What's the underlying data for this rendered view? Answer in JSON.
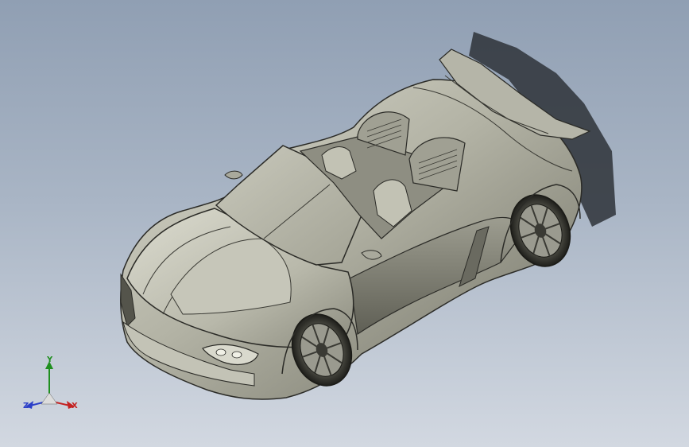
{
  "viewport": {
    "background_top": "#909fb3",
    "background_bottom": "#d2d8e1",
    "model": "sports-car-roadster",
    "model_color": "#b9b9ac"
  },
  "triad": {
    "x_label": "X",
    "y_label": "Y",
    "z_label": "Z",
    "x_color": "#c42222",
    "y_color": "#1f8f1f",
    "z_color": "#2b3fc8"
  }
}
